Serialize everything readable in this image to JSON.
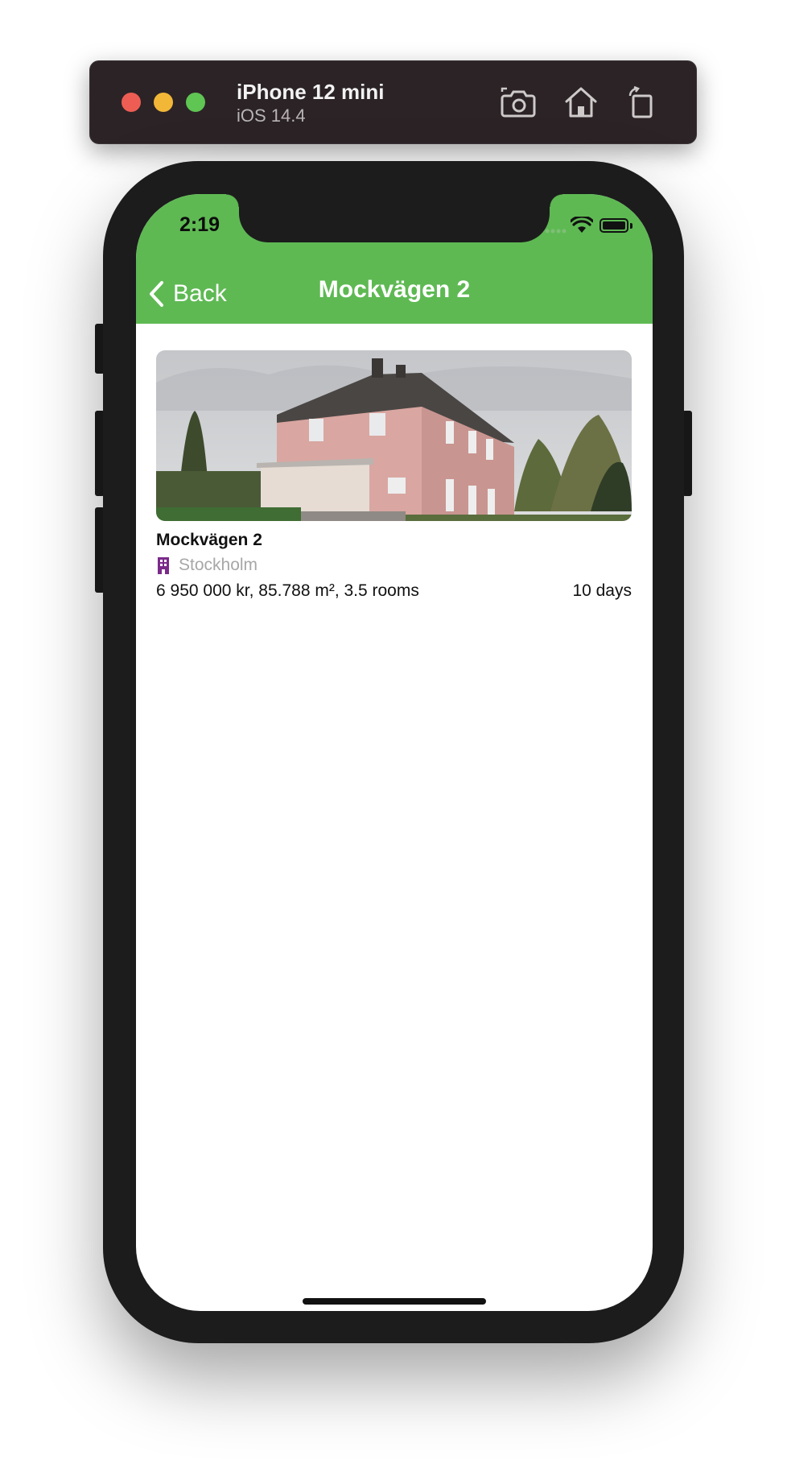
{
  "simulator": {
    "device_name": "iPhone 12 mini",
    "os_version": "iOS 14.4",
    "actions": [
      "screenshot-icon",
      "home-icon",
      "rotate-icon"
    ]
  },
  "status_bar": {
    "time": "2:19"
  },
  "nav_bar": {
    "back_label": "Back",
    "title": "Mockvägen 2",
    "color": "#5eb953"
  },
  "listing": {
    "title": "Mockvägen 2",
    "location_icon": "building-icon",
    "location_icon_color": "#7a2a8a",
    "location": "Stockholm",
    "details": "6 950 000 kr, 85.788 m², 3.5 rooms",
    "age": "10 days"
  }
}
